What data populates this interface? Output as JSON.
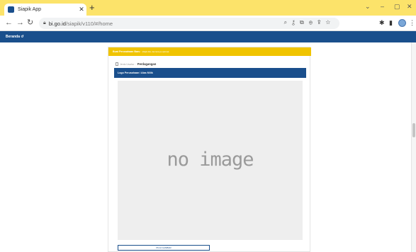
{
  "browser": {
    "tab_title": "Siapik App",
    "tab_close": "✕",
    "new_tab": "+",
    "url_host": "bi.go.id",
    "url_path": "/siapik/v110/#/home",
    "window_controls": [
      "⌄",
      "–",
      "▢",
      "✕"
    ]
  },
  "appbar": {
    "label": "Beranda ↺"
  },
  "card": {
    "header_title": "Buat Perusahaan Baru",
    "header_subtitle": "(Wajib diisi, dan lainnya optional)",
    "jenis_label": "Jenis Usaha :",
    "jenis_value": "Perdagangan",
    "section_title": "Logo Perusahaan / Atas Milik",
    "placeholder_text": "no image",
    "upload_button": "PILIH GAMBAR"
  },
  "colors": {
    "tabstrip": "#fce36a",
    "appbar": "#1a4f8c",
    "card_header": "#f0c400",
    "section_header": "#1a4f8c"
  }
}
